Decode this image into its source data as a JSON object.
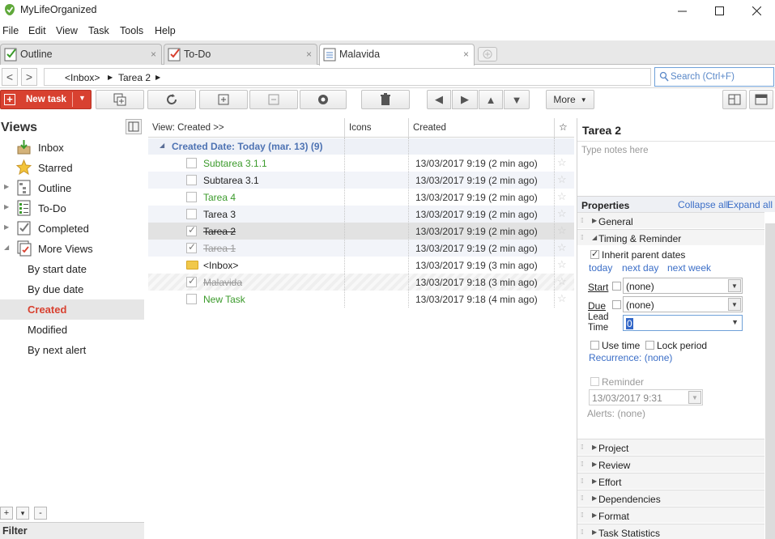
{
  "window": {
    "title": "MyLifeOrganized"
  },
  "menu": [
    "File",
    "Edit",
    "View",
    "Task",
    "Tools",
    "Help"
  ],
  "tabs": [
    {
      "label": "Outline",
      "close": "×"
    },
    {
      "label": "To-Do",
      "close": "×"
    },
    {
      "label": "Malavida",
      "close": "×"
    }
  ],
  "nav": {
    "back": "<",
    "forward": ">",
    "crumb_root": "<Inbox>",
    "crumb_task": "Tarea 2"
  },
  "search": {
    "placeholder": "Search (Ctrl+F)"
  },
  "toolbar": {
    "new_task": "New task",
    "more": "More"
  },
  "views": {
    "title": "Views",
    "items": [
      {
        "label": "Inbox"
      },
      {
        "label": "Starred"
      },
      {
        "label": "Outline"
      },
      {
        "label": "To-Do"
      },
      {
        "label": "Completed"
      },
      {
        "label": "More Views"
      },
      {
        "label": "By start date"
      },
      {
        "label": "By due date"
      },
      {
        "label": "Created"
      },
      {
        "label": "Modified"
      },
      {
        "label": "By next alert"
      }
    ],
    "add": "+",
    "dropdown": "▾",
    "remove": "-",
    "filter": "Filter"
  },
  "tasklist": {
    "view_label": "View: Created >>",
    "col_icons": "Icons",
    "col_created": "Created",
    "col_star": "☆",
    "group": "Created Date: Today (mar. 13)   (9)",
    "rows": [
      {
        "name": "Subtarea 3.1.1",
        "date": "13/03/2017 9:19 (2 min ago)",
        "star": "☆"
      },
      {
        "name": "Subtarea 3.1",
        "date": "13/03/2017 9:19 (2 min ago)",
        "star": "☆"
      },
      {
        "name": "Tarea 4",
        "date": "13/03/2017 9:19 (2 min ago)",
        "star": "☆"
      },
      {
        "name": "Tarea 3",
        "date": "13/03/2017 9:19 (2 min ago)",
        "star": "☆"
      },
      {
        "name": "Tarea 2",
        "date": "13/03/2017 9:19 (2 min ago)",
        "star": "☆"
      },
      {
        "name": "Tarea 1",
        "date": "13/03/2017 9:19 (2 min ago)",
        "star": "☆"
      },
      {
        "name": "<Inbox>",
        "date": "13/03/2017 9:19 (3 min ago)",
        "star": "☆"
      },
      {
        "name": "Malavida",
        "date": "13/03/2017 9:18 (3 min ago)",
        "star": "☆"
      },
      {
        "name": "New Task",
        "date": "13/03/2017 9:18 (4 min ago)",
        "star": "☆"
      }
    ]
  },
  "details": {
    "title": "Tarea 2",
    "notes_placeholder": "Type notes here",
    "properties": "Properties",
    "collapse_all": "Collapse all",
    "expand_all": "Expand all",
    "sections": {
      "general": "General",
      "timing": "Timing & Reminder",
      "project": "Project",
      "review": "Review",
      "effort": "Effort",
      "dependencies": "Dependencies",
      "format": "Format",
      "stats": "Task Statistics"
    },
    "timing": {
      "inherit": "Inherit parent dates",
      "today": "today",
      "next_day": "next day",
      "next_week": "next week",
      "start_label": "Start",
      "start_value": "(none)",
      "due_label": "Due",
      "due_value": "(none)",
      "lead_label_1": "Lead",
      "lead_label_2": "Time",
      "lead_value": "0",
      "use_time": "Use time",
      "lock_period": "Lock period",
      "recurrence": "Recurrence: (none)",
      "reminder": "Reminder",
      "reminder_value": "13/03/2017 9:31",
      "alerts": "Alerts: (none)"
    }
  },
  "colors": {
    "accent_red": "#d84130",
    "link_blue": "#3b6ec7",
    "green_task": "#3a9a2a",
    "group_blue": "#4e73b3"
  }
}
